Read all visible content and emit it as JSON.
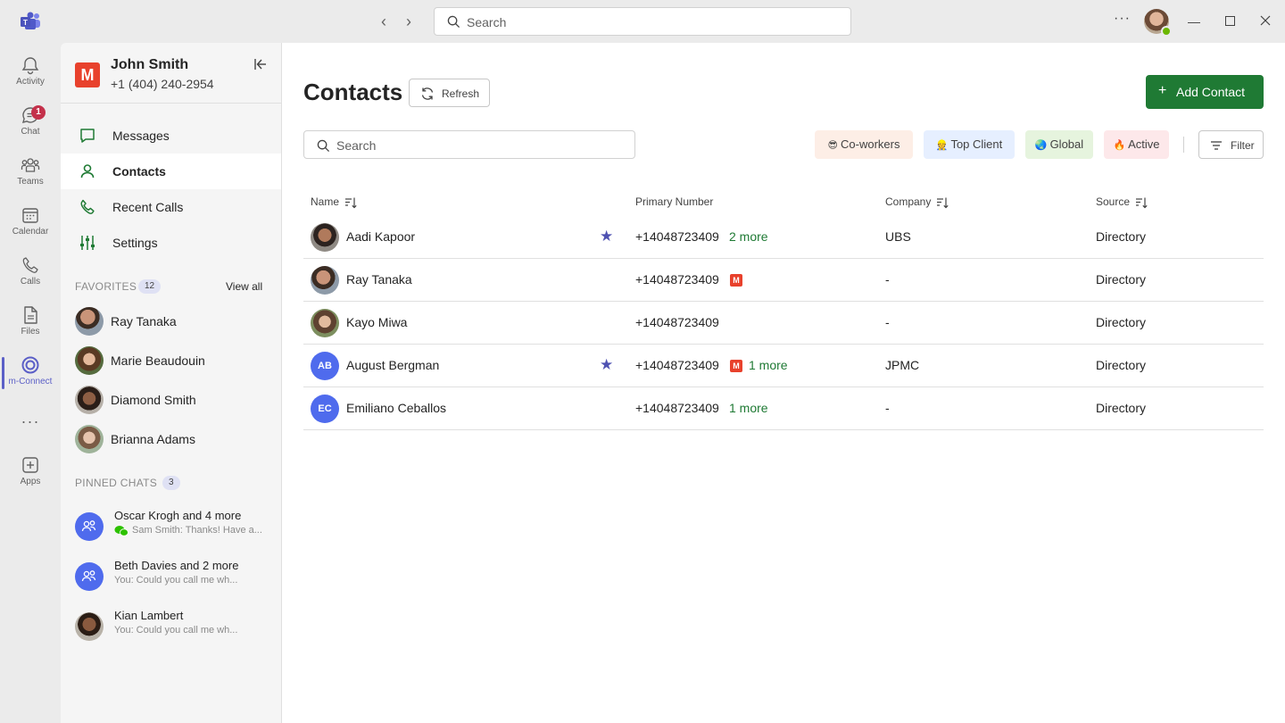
{
  "titlebar": {
    "search_placeholder": "Search",
    "more_label": "···"
  },
  "rail": [
    {
      "label": "Activity",
      "icon": "bell-icon"
    },
    {
      "label": "Chat",
      "icon": "chat-icon",
      "badge": "1"
    },
    {
      "label": "Teams",
      "icon": "teams-icon"
    },
    {
      "label": "Calendar",
      "icon": "calendar-icon"
    },
    {
      "label": "Calls",
      "icon": "phone-icon"
    },
    {
      "label": "Files",
      "icon": "file-icon"
    },
    {
      "label": "m-Connect",
      "icon": "mconnect-icon",
      "active": true
    },
    {
      "label": "Apps",
      "icon": "add-app-icon"
    }
  ],
  "account": {
    "logo_letter": "M",
    "name": "John Smith",
    "phone": "+1 (404) 240-2954"
  },
  "nav": [
    {
      "label": "Messages"
    },
    {
      "label": "Contacts",
      "active": true
    },
    {
      "label": "Recent Calls"
    },
    {
      "label": "Settings"
    }
  ],
  "favorites": {
    "title": "FAVORITES",
    "count": "12",
    "view_all": "View all",
    "items": [
      {
        "name": "Ray Tanaka"
      },
      {
        "name": "Marie Beaudouin"
      },
      {
        "name": "Diamond Smith"
      },
      {
        "name": "Brianna Adams"
      }
    ]
  },
  "pinned": {
    "title": "PINNED CHATS",
    "count": "3",
    "items": [
      {
        "name": "Oscar Krogh and 4 more",
        "preview": "Sam Smith: Thanks! Have a..."
      },
      {
        "name": "Beth Davies and 2 more",
        "preview": "You: Could you call me wh..."
      },
      {
        "name": "Kian Lambert",
        "preview": "You: Could you call me wh..."
      }
    ]
  },
  "main": {
    "title": "Contacts",
    "refresh_label": "Refresh",
    "add_label": "Add Contact",
    "search_placeholder": "Search",
    "filter_label": "Filter",
    "chips": [
      {
        "emoji": "😎",
        "label": "Co-workers",
        "color": "#fdeee6"
      },
      {
        "emoji": "👷",
        "label": "Top Client",
        "color": "#e6efff"
      },
      {
        "emoji": "🌏",
        "label": "Global",
        "color": "#e6f4de"
      },
      {
        "emoji": "🔥",
        "label": "Active",
        "color": "#fde8ea"
      }
    ],
    "columns": {
      "name": "Name",
      "primary": "Primary Number",
      "company": "Company",
      "source": "Source"
    },
    "rows": [
      {
        "name": "Aadi Kapoor",
        "initials": "",
        "starred": true,
        "number": "+14048723409",
        "mlogo": false,
        "more": "2 more",
        "company": "UBS",
        "source": "Directory"
      },
      {
        "name": "Ray Tanaka",
        "initials": "",
        "starred": false,
        "number": "+14048723409",
        "mlogo": true,
        "more": "",
        "company": "-",
        "source": "Directory"
      },
      {
        "name": "Kayo Miwa",
        "initials": "",
        "starred": false,
        "number": "+14048723409",
        "mlogo": false,
        "more": "",
        "company": "-",
        "source": "Directory"
      },
      {
        "name": "August Bergman",
        "initials": "AB",
        "starred": true,
        "number": "+14048723409",
        "mlogo": true,
        "more": "1 more",
        "company": "JPMC",
        "source": "Directory"
      },
      {
        "name": "Emiliano Ceballos",
        "initials": "EC",
        "starred": false,
        "number": "+14048723409",
        "mlogo": false,
        "more": "1 more",
        "company": "-",
        "source": "Directory"
      }
    ]
  },
  "colors": {
    "accent": "#5b5fc7",
    "primary_button": "#1f7a34",
    "star": "#4f52b2",
    "initials_avatar": "#4f6bed",
    "brand_red": "#e8412c"
  }
}
